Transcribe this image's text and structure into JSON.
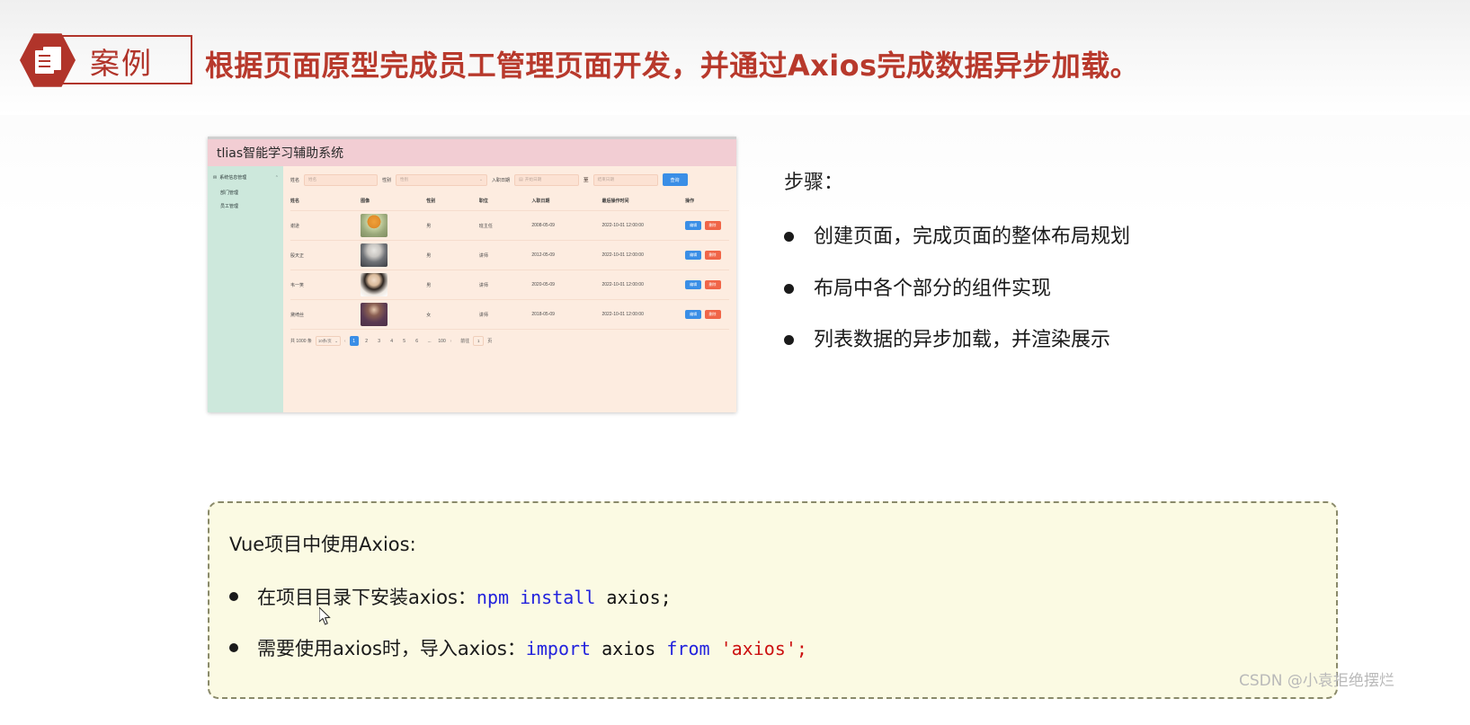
{
  "header": {
    "badge_label": "案例",
    "badge_icon": "document-hexagon-icon",
    "title": "根据页面原型完成员工管理页面开发，并通过Axios完成数据异步加载。",
    "accent_color": "#b8392c"
  },
  "mockup": {
    "window_title": "tlias智能学习辅助系统",
    "titlebar_color": "#f2cdd3",
    "body_color": "#fdece0",
    "sidebar": {
      "color": "#cde8dc",
      "group_label": "系统信息管理",
      "group_icon": "envelope-icon",
      "caret_icon": "chevron-up-icon",
      "items": [
        {
          "label": "部门管理"
        },
        {
          "label": "员工管理"
        }
      ]
    },
    "search": {
      "name_label": "姓名",
      "name_placeholder": "姓名",
      "gender_label": "性别",
      "gender_placeholder": "性别",
      "gender_caret": "chevron-down-icon",
      "hiredate_label": "入职日期",
      "date_icon": "calendar-icon",
      "start_placeholder": "开始日期",
      "range_sep": "至",
      "end_placeholder": "结束日期",
      "search_button": "查询",
      "button_color": "#3a8ee6"
    },
    "table": {
      "headers": [
        "姓名",
        "图像",
        "性别",
        "职位",
        "入职日期",
        "最后操作时间",
        "操作"
      ],
      "rows": [
        {
          "name": "谢逊",
          "avatar": "avatar-xiexun",
          "gender": "男",
          "job": "班主任",
          "hire": "2008-05-09",
          "last": "2022-10-01 12:00:00",
          "edit": "编辑",
          "delete": "删除"
        },
        {
          "name": "殷天正",
          "avatar": "avatar-yintianzheng",
          "gender": "男",
          "job": "讲师",
          "hire": "2012-05-09",
          "last": "2022-10-01 12:00:00",
          "edit": "编辑",
          "delete": "删除"
        },
        {
          "name": "韦一笑",
          "avatar": "avatar-weiyixiao",
          "gender": "男",
          "job": "讲师",
          "hire": "2020-05-09",
          "last": "2022-10-01 12:00:00",
          "edit": "编辑",
          "delete": "删除"
        },
        {
          "name": "黛绮丝",
          "avatar": "avatar-daiqisi",
          "gender": "女",
          "job": "讲师",
          "hire": "2018-05-09",
          "last": "2022-10-01 12:00:00",
          "edit": "编辑",
          "delete": "删除"
        }
      ]
    },
    "pagination": {
      "total_text": "共 1000 条",
      "page_size": "10条/页",
      "prev_icon": "chevron-left-icon",
      "next_icon": "chevron-right-icon",
      "pages": [
        "1",
        "2",
        "3",
        "4",
        "5",
        "6"
      ],
      "ellipsis": "...",
      "last_page": "100",
      "active_page": "1",
      "jump_label": "前往",
      "jump_value": "1",
      "jump_unit": "页"
    }
  },
  "steps": {
    "title": "步骤：",
    "items": [
      {
        "text": "创建页面，完成页面的整体布局规划"
      },
      {
        "text": "布局中各个部分的组件实现"
      },
      {
        "text": "列表数据的异步加载，并渲染展示"
      }
    ]
  },
  "codebox": {
    "heading": "Vue项目中使用Axios:",
    "items": [
      {
        "prefix": "在项目目录下安装axios：",
        "code_blue": "npm  install",
        "code_dark": " axios;",
        "code_red": ""
      },
      {
        "prefix": "需要使用axios时，导入axios：",
        "code_blue": "import",
        "code_dark": " axios ",
        "code_blue2": "from",
        "code_red": " 'axios';"
      }
    ],
    "background": "#fbfae3",
    "border_color": "#8a8a6a"
  },
  "watermark": "CSDN @小袁拒绝摆烂"
}
